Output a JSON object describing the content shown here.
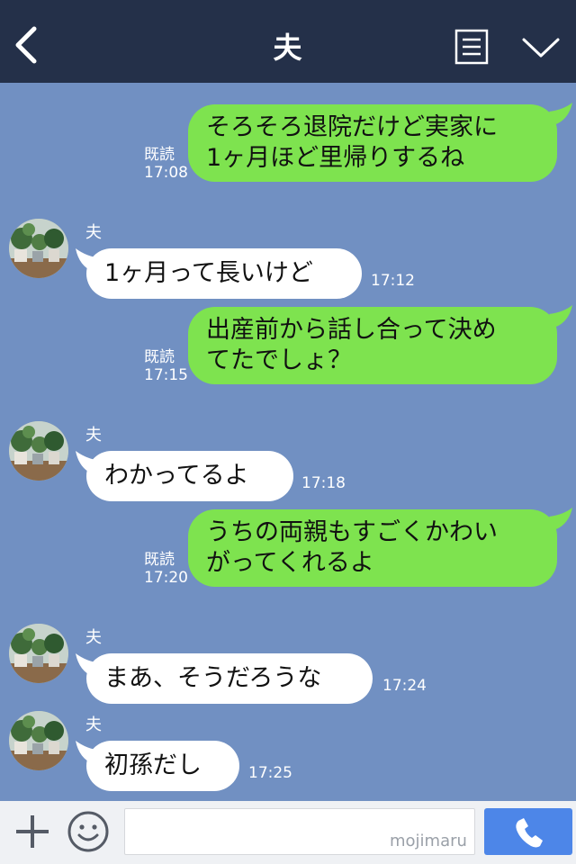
{
  "header": {
    "title": "夫",
    "back_icon": "chevron-left-icon",
    "menu_icon": "note-list-icon",
    "down_icon": "chevron-down-icon",
    "background": "#243049"
  },
  "chat": {
    "background": "#7190c2",
    "messages": [
      {
        "side": "right",
        "line1": "そろそろ退院だけど実家に",
        "line2": "1ヶ月ほど里帰りするね",
        "read": "既読",
        "time": "17:08"
      },
      {
        "side": "left",
        "sender": "夫",
        "text": "1ヶ月って長いけど",
        "time": "17:12"
      },
      {
        "side": "right",
        "line1": "出産前から話し合って決め",
        "line2": "てたでしょ？",
        "read": "既読",
        "time": "17:15"
      },
      {
        "side": "left",
        "sender": "夫",
        "text": "わかってるよ",
        "time": "17:18"
      },
      {
        "side": "right",
        "line1": "うちの両親もすごくかわい",
        "line2": "がってくれるよ",
        "read": "既読",
        "time": "17:20"
      },
      {
        "side": "left",
        "sender": "夫",
        "text": "まあ、そうだろうな",
        "time": "17:24"
      },
      {
        "side": "left",
        "sender": "夫",
        "text": "初孫だし",
        "time": "17:25"
      }
    ],
    "colors": {
      "sent": "#7ee34f",
      "received": "#ffffff"
    }
  },
  "input_bar": {
    "plus_icon": "plus-icon",
    "emoji_icon": "smiley-icon",
    "input_value": "",
    "watermark": "mojimaru",
    "call_icon": "phone-icon",
    "call_color": "#4d86e8"
  }
}
